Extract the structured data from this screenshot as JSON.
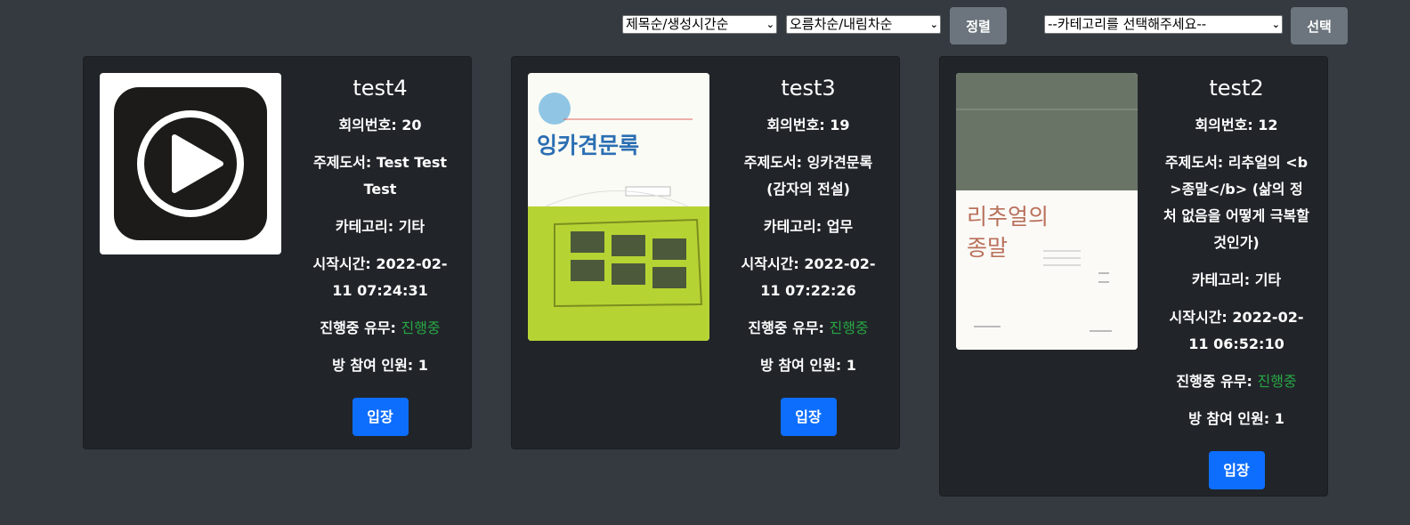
{
  "toolbar": {
    "sort_field": "제목순/생성시간순",
    "sort_order": "오름차순/내림차순",
    "sort_button": "정렬",
    "category_select": "--카테고리를 선택해주세요--",
    "select_button": "선택"
  },
  "labels": {
    "meeting_no": "회의번호: ",
    "book": "주제도서: ",
    "category": "카테고리: ",
    "start_time": "시작시간: ",
    "in_progress": "진행중 유무: ",
    "participants": "방 참여 인원: ",
    "enter": "입장"
  },
  "cards": [
    {
      "title": "test4",
      "meeting_no": "20",
      "book": "Test Test Test",
      "category": "기타",
      "start_time": "2022-02-11 07:24:31",
      "status": "진행중",
      "participants": "1",
      "thumb_icon": "play-icon"
    },
    {
      "title": "test3",
      "meeting_no": "19",
      "book": "잉카견문록 (감자의 전설)",
      "category": "업무",
      "start_time": "2022-02-11 07:22:26",
      "status": "진행중",
      "participants": "1",
      "cover_title": "잉카견문록"
    },
    {
      "title": "test2",
      "meeting_no": "12",
      "book": "리추얼의 <b>종말</b> (삶의 정처 없음을 어떻게 극복할 것인가)",
      "category": "기타",
      "start_time": "2022-02-11 06:52:10",
      "status": "진행중",
      "participants": "1",
      "cover_title_1": "리추얼의",
      "cover_title_2": "종말"
    }
  ],
  "colors": {
    "background": "#343a40",
    "card": "#212529",
    "status_green": "#28a745",
    "primary": "#0d6efd",
    "secondary": "#6c757d"
  }
}
